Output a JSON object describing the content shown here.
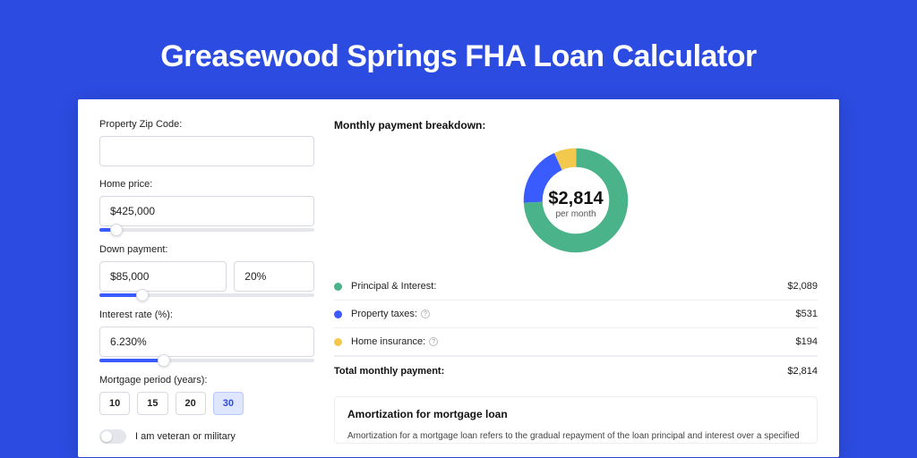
{
  "title": "Greasewood Springs FHA Loan Calculator",
  "form": {
    "zip": {
      "label": "Property Zip Code:",
      "value": ""
    },
    "home_price": {
      "label": "Home price:",
      "value": "$425,000",
      "slider_pct": 8
    },
    "down_payment": {
      "label": "Down payment:",
      "value": "$85,000",
      "pct_value": "20%",
      "slider_pct": 20
    },
    "interest": {
      "label": "Interest rate (%):",
      "value": "6.230%",
      "slider_pct": 30
    },
    "period": {
      "label": "Mortgage period (years):",
      "options": [
        "10",
        "15",
        "20",
        "30"
      ],
      "active": "30"
    },
    "veteran": {
      "label": "I am veteran or military",
      "checked": false
    }
  },
  "breakdown": {
    "title": "Monthly payment breakdown:",
    "total_amount": "$2,814",
    "total_sub": "per month",
    "items": [
      {
        "label": "Principal & Interest:",
        "value": "$2,089",
        "color": "#4bb38a",
        "info": false
      },
      {
        "label": "Property taxes:",
        "value": "$531",
        "color": "#3a5cff",
        "info": true
      },
      {
        "label": "Home insurance:",
        "value": "$194",
        "color": "#f2c94c",
        "info": true
      }
    ],
    "total_row": {
      "label": "Total monthly payment:",
      "value": "$2,814"
    }
  },
  "chart_data": {
    "type": "pie",
    "title": "Monthly payment breakdown",
    "series": [
      {
        "name": "Principal & Interest",
        "value": 2089,
        "color": "#4bb38a"
      },
      {
        "name": "Property taxes",
        "value": 531,
        "color": "#3a5cff"
      },
      {
        "name": "Home insurance",
        "value": 194,
        "color": "#f2c94c"
      }
    ],
    "total": 2814,
    "center_label": "$2,814",
    "center_sub": "per month"
  },
  "amortization": {
    "title": "Amortization for mortgage loan",
    "text": "Amortization for a mortgage loan refers to the gradual repayment of the loan principal and interest over a specified"
  }
}
